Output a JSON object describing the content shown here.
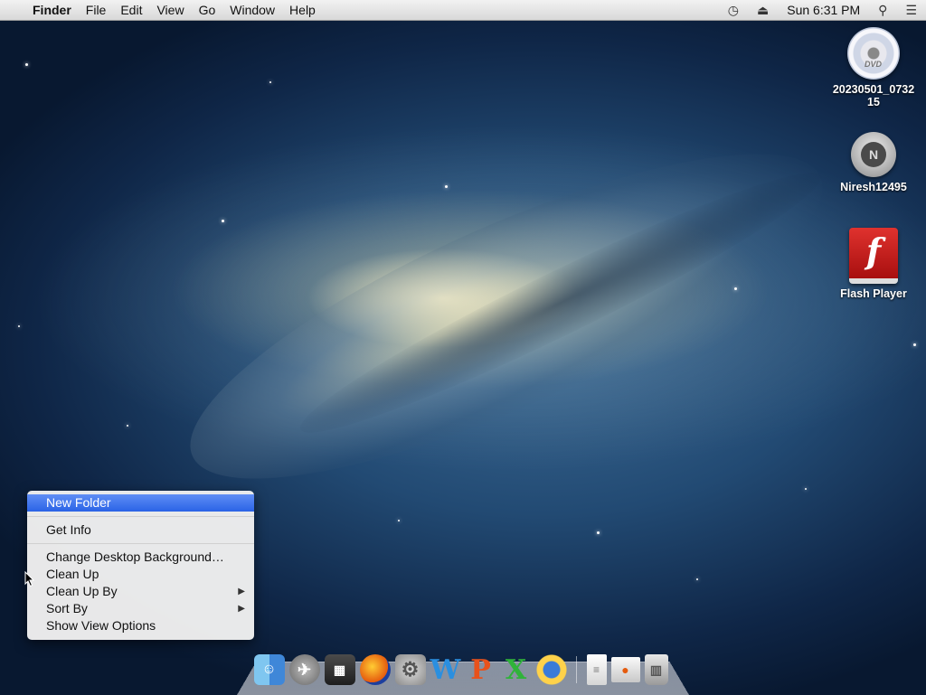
{
  "menubar": {
    "apple_icon": "",
    "app_name": "Finder",
    "menus": [
      "File",
      "Edit",
      "View",
      "Go",
      "Window",
      "Help"
    ],
    "clock": "Sun 6:31 PM",
    "status_icons": [
      "time-machine-icon",
      "eject-icon",
      "spotlight-icon",
      "notification-center-icon"
    ]
  },
  "desktop_icons": [
    {
      "label": "20230501_073215",
      "icon": "dvd-disc-icon"
    },
    {
      "label": "Niresh12495",
      "icon": "user-disk-icon"
    },
    {
      "label": "Flash Player",
      "icon": "flash-player-icon"
    }
  ],
  "context_menu": {
    "items": [
      {
        "label": "New Folder",
        "selected": true
      },
      {
        "label": "Get Info"
      },
      {
        "label": "Change Desktop Background…"
      },
      {
        "label": "Clean Up"
      },
      {
        "label": "Clean Up By",
        "submenu": true
      },
      {
        "label": "Sort By",
        "submenu": true
      },
      {
        "label": "Show View Options"
      }
    ]
  },
  "dock": {
    "apps": [
      "finder-icon",
      "launchpad-icon",
      "dashboard-icon",
      "firefox-icon",
      "system-preferences-icon",
      "word-icon",
      "powerpoint-icon",
      "excel-icon",
      "sun-app-icon",
      "document-icon",
      "window-preview-icon",
      "trash-icon"
    ]
  },
  "colors": {
    "selection": "#2a63e6",
    "menubar": "#e5e5e5",
    "flash_red": "#d42424"
  }
}
